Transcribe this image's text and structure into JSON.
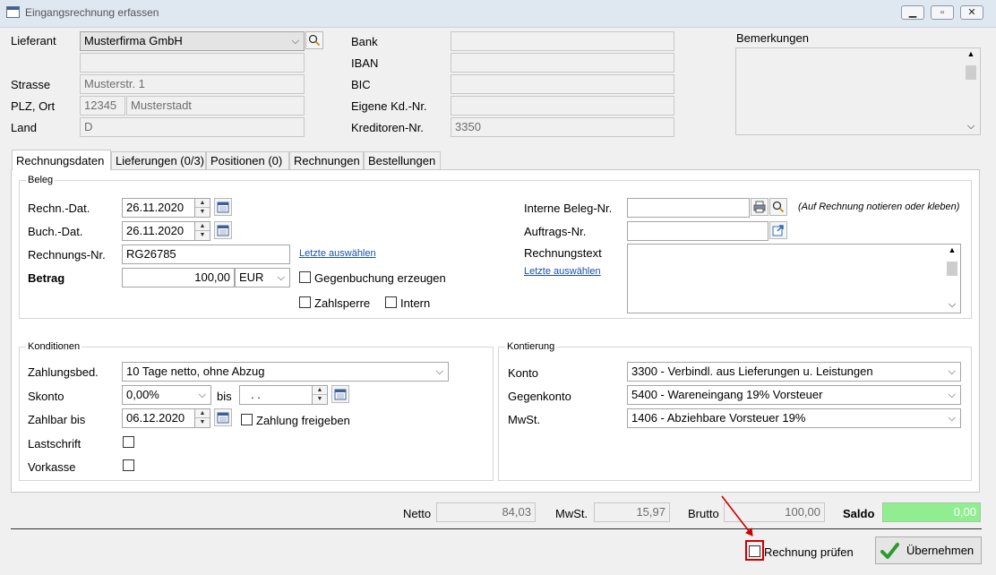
{
  "window": {
    "title": "Eingangsrechnung erfassen",
    "min_label": "▭",
    "restore_label": "⧉",
    "close_label": "✕"
  },
  "supplier": {
    "label_lieferant": "Lieferant",
    "lieferant_value": "Musterfirma GmbH",
    "line2_value": "",
    "label_strasse": "Strasse",
    "strasse_value": "Musterstr. 1",
    "label_plz_ort": "PLZ, Ort",
    "plz_value": "12345",
    "ort_value": "Musterstadt",
    "label_land": "Land",
    "land_value": "D",
    "label_bank": "Bank",
    "bank_value": "",
    "label_iban": "IBAN",
    "iban_value": "",
    "label_bic": "BIC",
    "bic_value": "",
    "label_eigene": "Eigene Kd.-Nr.",
    "eigene_value": "",
    "label_kreditoren": "Kreditoren-Nr.",
    "kreditoren_value": "3350",
    "label_bemerkungen": "Bemerkungen",
    "bemerkungen_value": ""
  },
  "tabs": [
    "Rechnungsdaten",
    "Lieferungen (0/3)",
    "Positionen (0)",
    "Rechnungen",
    "Bestellungen"
  ],
  "beleg": {
    "group_label": "Beleg",
    "label_rechn_dat": "Rechn.-Dat.",
    "rechn_dat": "26.11.2020",
    "label_buch_dat": "Buch.-Dat.",
    "buch_dat": "26.11.2020",
    "label_rechnungs_nr": "Rechnungs-Nr.",
    "rechnungs_nr": "RG26785",
    "letzte_link": "Letzte auswählen",
    "label_betrag": "Betrag",
    "betrag": "100,00",
    "currency": "EUR",
    "gegenbuchung": "Gegenbuchung erzeugen",
    "zahlsperre": "Zahlsperre",
    "intern": "Intern",
    "label_interne_beleg": "Interne Beleg-Nr.",
    "interne_beleg": "",
    "hint": "(Auf Rechnung notieren oder kleben)",
    "label_auftrags": "Auftrags-Nr.",
    "auftrags": "",
    "label_rechnungstext": "Rechnungstext",
    "rechnungstext": "",
    "letzte_link2": "Letzte auswählen"
  },
  "konditionen": {
    "group_label": "Konditionen",
    "label_zahlungsbed": "Zahlungsbed.",
    "zahlungsbed": "10 Tage netto, ohne Abzug",
    "label_skonto": "Skonto",
    "skonto": "0,00%",
    "label_bis": "bis",
    "bis_value": ". .",
    "label_zahlbar": "Zahlbar bis",
    "zahlbar": "06.12.2020",
    "zahlung_freigeben": "Zahlung freigeben",
    "label_lastschrift": "Lastschrift",
    "label_vorkasse": "Vorkasse"
  },
  "kontierung": {
    "group_label": "Kontierung",
    "label_konto": "Konto",
    "konto": "3300 - Verbindl. aus Lieferungen u. Leistungen",
    "label_gegenkonto": "Gegenkonto",
    "gegenkonto": "5400 - Wareneingang 19% Vorsteuer",
    "label_mwst": "MwSt.",
    "mwst": "1406 - Abziehbare Vorsteuer 19%"
  },
  "totals": {
    "label_netto": "Netto",
    "netto": "84,03",
    "label_mwst": "MwSt.",
    "mwst": "15,97",
    "label_brutto": "Brutto",
    "brutto": "100,00",
    "label_saldo": "Saldo",
    "saldo": "0,00"
  },
  "footer": {
    "pruefen_label": "Rechnung prüfen",
    "uebernehmen_label": "Übernehmen"
  },
  "colors": {
    "saldo_bg": "#90ee90",
    "highlight": "#cc0000",
    "link": "#1a50a8",
    "check": "#2e9a2e"
  }
}
